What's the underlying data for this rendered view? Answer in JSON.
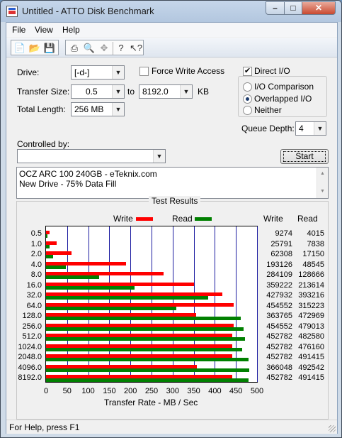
{
  "window": {
    "title": "Untitled - ATTO Disk Benchmark"
  },
  "menu": [
    "File",
    "View",
    "Help"
  ],
  "toolbar": {
    "icons": [
      "new-icon",
      "open-icon",
      "save-icon",
      "print-icon",
      "print-preview-icon",
      "move-icon",
      "help-icon",
      "context-help-icon"
    ]
  },
  "form": {
    "drive_label": "Drive:",
    "drive_value": "[-d-]",
    "force_write_label": "Force Write Access",
    "force_write_checked": false,
    "direct_io_label": "Direct I/O",
    "direct_io_checked": true,
    "transfer_size_label": "Transfer Size:",
    "transfer_from": "0.5",
    "to_label": "to",
    "transfer_to": "8192.0",
    "kb_label": "KB",
    "total_length_label": "Total Length:",
    "total_length_value": "256 MB",
    "io_comparison_label": "I/O Comparison",
    "overlapped_io_label": "Overlapped I/O",
    "neither_label": "Neither",
    "selected_io_mode": "Overlapped I/O",
    "queue_depth_label": "Queue Depth:",
    "queue_depth_value": "4",
    "controlled_by_label": "Controlled by:",
    "controlled_by_value": "",
    "start_label": "Start",
    "description_line1": "OCZ ARC 100 240GB - eTeknix.com",
    "description_line2": "New Drive - 75% Data Fill"
  },
  "results": {
    "title": "Test Results",
    "write_legend": "Write",
    "read_legend": "Read",
    "write_col": "Write",
    "read_col": "Read",
    "write_color": "#ff0000",
    "read_color": "#008000"
  },
  "chart_data": {
    "type": "bar",
    "orientation": "horizontal",
    "xlabel": "Transfer Rate - MB / Sec",
    "xlim": [
      0,
      500
    ],
    "xticks": [
      "0",
      "50",
      "100",
      "150",
      "200",
      "250",
      "300",
      "350",
      "400",
      "450",
      "500"
    ],
    "categories": [
      "0.5",
      "1.0",
      "2.0",
      "4.0",
      "8.0",
      "16.0",
      "32.0",
      "64.0",
      "128.0",
      "256.0",
      "512.0",
      "1024.0",
      "2048.0",
      "4096.0",
      "8192.0"
    ],
    "series": [
      {
        "name": "Write",
        "values": [
          9,
          25,
          61,
          189,
          278,
          351,
          418,
          444,
          355,
          444,
          442,
          442,
          442,
          357,
          442
        ]
      },
      {
        "name": "Read",
        "values": [
          4,
          8,
          17,
          47,
          126,
          209,
          384,
          308,
          462,
          468,
          471,
          465,
          480,
          481,
          480
        ]
      }
    ],
    "write_numbers": [
      "9274",
      "25791",
      "62308",
      "193126",
      "284109",
      "359222",
      "427932",
      "454552",
      "363765",
      "454552",
      "452782",
      "452782",
      "452782",
      "366048",
      "452782"
    ],
    "read_numbers": [
      "4015",
      "7838",
      "17150",
      "48545",
      "128666",
      "213614",
      "393216",
      "315223",
      "472969",
      "479013",
      "482580",
      "476160",
      "491415",
      "492542",
      "491415"
    ]
  },
  "status": {
    "text": "For Help, press F1"
  }
}
